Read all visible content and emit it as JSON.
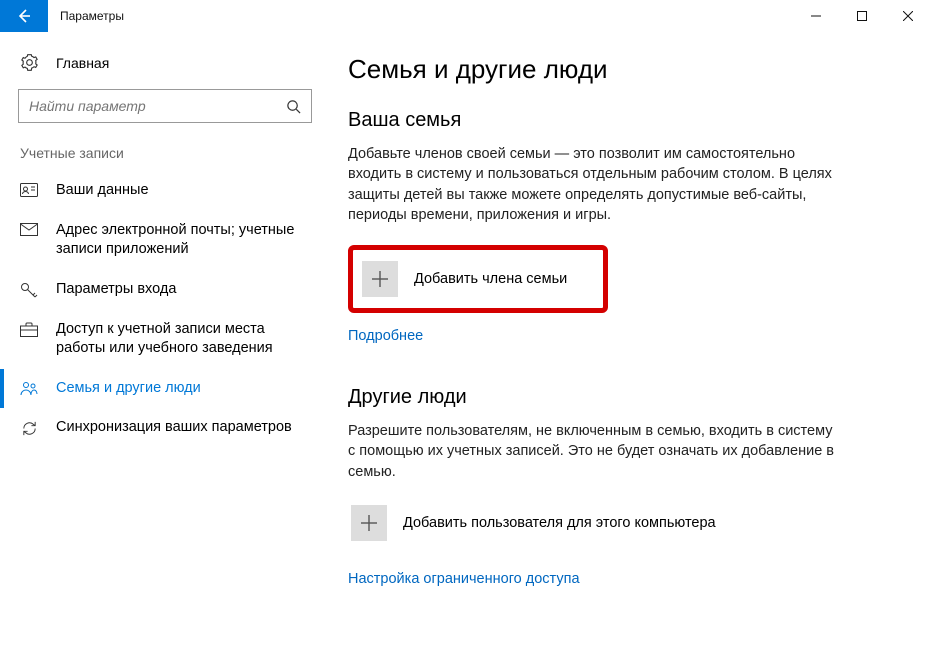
{
  "window": {
    "title": "Параметры"
  },
  "sidebar": {
    "home": "Главная",
    "search_placeholder": "Найти параметр",
    "group": "Учетные записи",
    "items": [
      {
        "label": "Ваши данные"
      },
      {
        "label": "Адрес электронной почты; учетные записи приложений"
      },
      {
        "label": "Параметры входа"
      },
      {
        "label": "Доступ к учетной записи места работы или учебного заведения"
      },
      {
        "label": "Семья и другие люди"
      },
      {
        "label": "Синхронизация ваших параметров"
      }
    ]
  },
  "main": {
    "title": "Семья и другие люди",
    "family": {
      "heading": "Ваша семья",
      "desc": "Добавьте членов своей семьи — это позволит им самостоятельно входить в систему и пользоваться отдельным рабочим столом. В целях защиты детей вы также можете определять допустимые веб-сайты, периоды времени, приложения и игры.",
      "add_label": "Добавить члена семьи",
      "more_link": "Подробнее"
    },
    "others": {
      "heading": "Другие люди",
      "desc": "Разрешите пользователям, не включенным в семью, входить в систему с помощью их учетных записей. Это не будет означать их добавление в семью.",
      "add_label": "Добавить пользователя для этого компьютера",
      "restricted_link": "Настройка ограниченного доступа"
    }
  }
}
